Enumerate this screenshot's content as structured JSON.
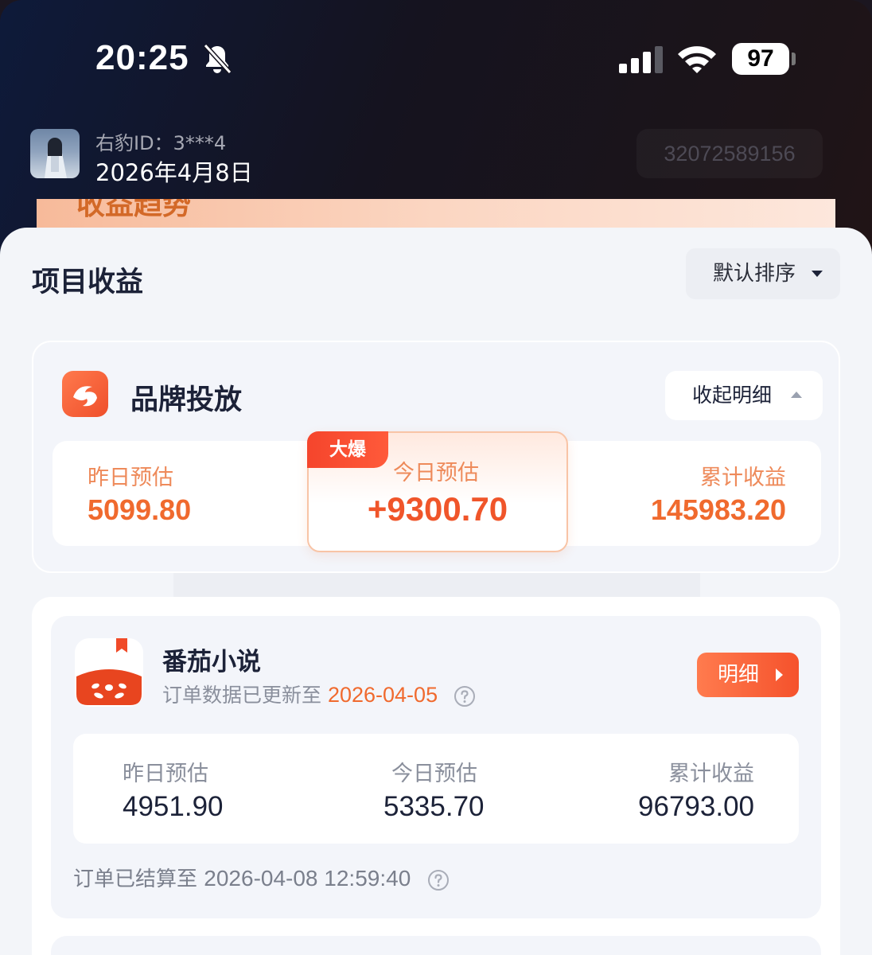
{
  "status_bar": {
    "time": "20:25",
    "battery": "97",
    "icons": [
      "bell-off-icon",
      "signal-icon",
      "wifi-icon",
      "battery-icon"
    ]
  },
  "user": {
    "id_label": "右豹ID：3***4",
    "date": "2026年4月8日",
    "account_number": "32072589156"
  },
  "peek_banner": {
    "text": "收益趋势"
  },
  "section": {
    "title": "项目收益",
    "sort_label": "默认排序"
  },
  "brand": {
    "name": "品牌投放",
    "collapse_label": "收起明细",
    "hot_badge": "大爆",
    "yesterday_label": "昨日预估",
    "yesterday_value": "5099.80",
    "today_label": "今日预估",
    "today_value": "+9300.70",
    "total_label": "累计收益",
    "total_value": "145983.20"
  },
  "novel": {
    "name": "番茄小说",
    "update_prefix": "订单数据已更新至",
    "update_date": "2026-04-05",
    "detail_label": "明细",
    "yesterday_label": "昨日预估",
    "yesterday_value": "4951.90",
    "today_label": "今日预估",
    "today_value": "5335.70",
    "total_label": "累计收益",
    "total_value": "96793.00",
    "settle_prefix": "订单已结算至",
    "settle_time": "2026-04-08 12:59:40"
  },
  "colors": {
    "accent": "#f06a2e",
    "hot_badge": "#f5452c",
    "text_primary": "#1c2238",
    "text_muted": "#8a8f9c"
  }
}
